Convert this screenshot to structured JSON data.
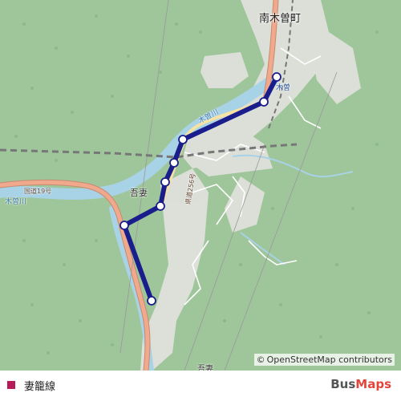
{
  "map": {
    "town_label": "南木曽町",
    "station_label": "吾妻",
    "station_label_2": "木曽",
    "river_label_1": "木曽川",
    "river_label_2": "木曽川",
    "road_label_1": "国道19号",
    "road_label_2": "県道256号",
    "bottom_label": "吾妻",
    "attribution_symbol": "©",
    "attribution_text": "OpenStreetMap contributors",
    "colors": {
      "forest": "#9fc69a",
      "river": "#a8d2e6",
      "urban": "#e2e2de",
      "primary_road": "#f0a98c",
      "route": "#1a1d8c"
    }
  },
  "legend": {
    "route_name": "妻籠線",
    "route_color": "#b51b58"
  },
  "brand": {
    "part1": "Bus",
    "part2": "Maps"
  }
}
